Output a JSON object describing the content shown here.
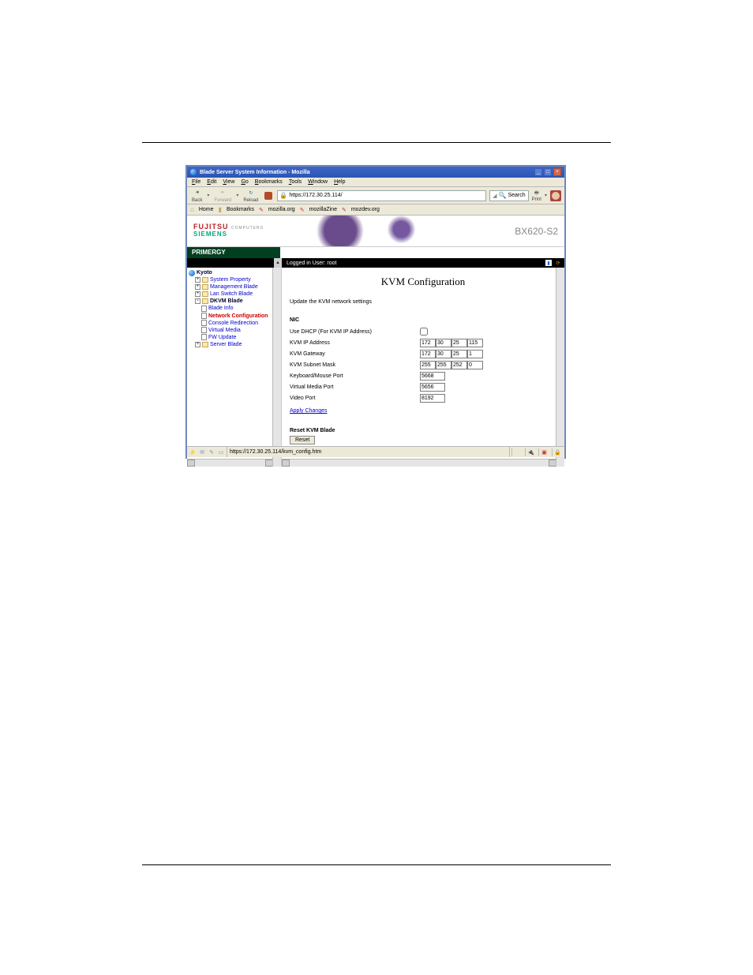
{
  "window": {
    "title": "Blade Server System Information - Mozilla",
    "minimize": "_",
    "maximize": "□",
    "close": "×"
  },
  "menu": {
    "file": "File",
    "edit": "Edit",
    "view": "View",
    "go": "Go",
    "bookmarks": "Bookmarks",
    "tools": "Tools",
    "window": "Window",
    "help": "Help"
  },
  "toolbar": {
    "back": "Back",
    "forward": "Forward",
    "reload": "Reload",
    "url": "https://172.30.25.114/",
    "search": "Search",
    "print": "Print"
  },
  "bookmarks": {
    "home": "Home",
    "bookmarks": "Bookmarks",
    "m1": "mozilla.org",
    "m2": "mozillaZine",
    "m3": "mozdev.org"
  },
  "brand": {
    "line1": "FUJITSU",
    "line1sub": "COMPUTERS",
    "line2": "SIEMENS",
    "model": "BX620-S2",
    "primergy": "PRIMERGY"
  },
  "login_bar": {
    "text": "Logged in User: root"
  },
  "tree": {
    "root": "Kyoto",
    "items": [
      {
        "label": "System Property",
        "exp": "+"
      },
      {
        "label": "Management Blade",
        "exp": "+"
      },
      {
        "label": "Lan Switch Blade",
        "exp": "+"
      },
      {
        "label": "DKVM Blade",
        "exp": "-",
        "active_parent": true
      },
      {
        "label": "Blade Info",
        "leaf": true,
        "indent": 2
      },
      {
        "label": "Network Configuration",
        "leaf": true,
        "indent": 2,
        "active": true
      },
      {
        "label": "Console Redirection",
        "leaf": true,
        "indent": 2
      },
      {
        "label": "Virtual Media",
        "leaf": true,
        "indent": 2
      },
      {
        "label": "FW Update",
        "leaf": true,
        "indent": 2
      },
      {
        "label": "Server Blade",
        "exp": "+"
      }
    ]
  },
  "main": {
    "title": "KVM Configuration",
    "instruction": "Update the KVM network settings",
    "nic": "NIC",
    "rows": {
      "use_dhcp": "Use DHCP (For KVM IP Address)",
      "ip": "KVM IP Address",
      "gw": "KVM Gateway",
      "mask": "KVM Subnet Mask",
      "kmport": "Keyboard/Mouse Port",
      "vmport": "Virtual Media Port",
      "vport": "Video Port"
    },
    "values": {
      "ip": [
        "172",
        "30",
        "25",
        "115"
      ],
      "gw": [
        "172",
        "30",
        "25",
        "1"
      ],
      "mask": [
        "255",
        "255",
        "252",
        "0"
      ],
      "kmport": "5668",
      "vmport": "5656",
      "vport": "8192"
    },
    "apply": "Apply Changes",
    "reset_title": "Reset KVM Blade",
    "reset_btn": "Reset"
  },
  "status": {
    "url": "https://172.30.25.114/kvm_config.htm"
  }
}
